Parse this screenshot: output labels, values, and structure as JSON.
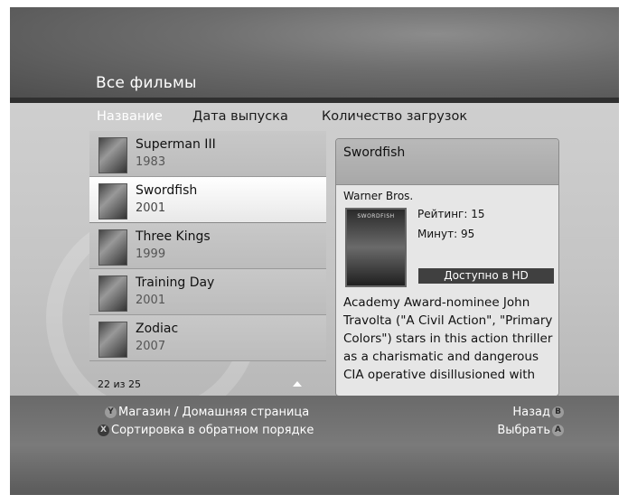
{
  "header": {
    "title": "Все фильмы"
  },
  "tabs": [
    {
      "label": "Название"
    },
    {
      "label": "Дата выпуска"
    },
    {
      "label": "Количество загрузок"
    }
  ],
  "movies": [
    {
      "title": "Superman III",
      "year": "1983"
    },
    {
      "title": "Swordfish",
      "year": "2001"
    },
    {
      "title": "Three Kings",
      "year": "1999"
    },
    {
      "title": "Training Day",
      "year": "2001"
    },
    {
      "title": "Zodiac",
      "year": "2007"
    }
  ],
  "list": {
    "count": "22 из 25"
  },
  "details": {
    "title": "Swordfish",
    "studio": "Warner Bros.",
    "rating": "Рейтинг: 15",
    "minutes": "Минут: 95",
    "hd": "Доступно в HD",
    "poster_label": "SWORDFISH",
    "synopsis": "Academy Award-nominee John Travolta (\"A Civil Action\", \"Primary Colors\") stars in this action thriller as a charismatic and dangerous CIA operative disillusioned with"
  },
  "footer": {
    "store": {
      "button": "Y",
      "label": "Магазин / Домашняя страница"
    },
    "sort": {
      "button": "X",
      "label": "Сортировка в обратном порядке"
    },
    "back": {
      "button": "B",
      "label": "Назад"
    },
    "select": {
      "button": "A",
      "label": "Выбрать"
    }
  }
}
